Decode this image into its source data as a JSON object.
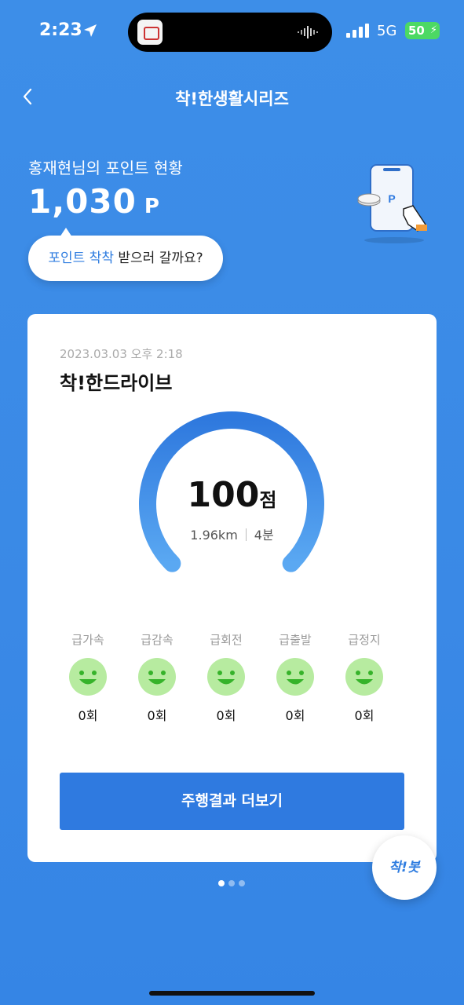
{
  "status_bar": {
    "time": "2:23",
    "network": "5G",
    "battery": "50"
  },
  "header": {
    "title": "착!한생활시리즈"
  },
  "points": {
    "label": "홍재현님의 포인트 현황",
    "value": "1,030",
    "unit": "P",
    "illustration_letter": "P"
  },
  "bubble": {
    "highlight": "포인트 착착",
    "rest": " 받으러 갈까요?"
  },
  "card": {
    "date": "2023.03.03 오후 2:18",
    "title": "착!한드라이브",
    "score": "100",
    "score_unit": "점",
    "distance": "1.96km",
    "duration": "4분",
    "score_fraction": 1.0,
    "events": [
      {
        "label": "급가속",
        "count": "0회"
      },
      {
        "label": "급감속",
        "count": "0회"
      },
      {
        "label": "급회전",
        "count": "0회"
      },
      {
        "label": "급출발",
        "count": "0회"
      },
      {
        "label": "급정지",
        "count": "0회"
      }
    ],
    "more_button": "주행결과 더보기"
  },
  "carousel": {
    "page_count": 3,
    "active_index": 0
  },
  "bot_button": {
    "label": "착!봇"
  },
  "colors": {
    "background": "#3a89e6",
    "accent": "#2f7ae0",
    "smile_face": "#b7eba0",
    "smile_mouth": "#36b32a"
  }
}
